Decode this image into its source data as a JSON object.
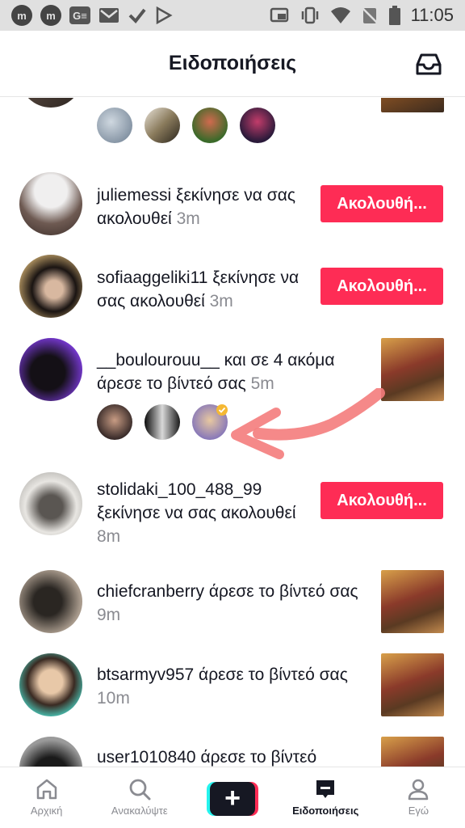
{
  "status_bar": {
    "time": "11:05",
    "left_icons": [
      "m-icon",
      "m-icon",
      "gmail-e-icon",
      "gmail-icon",
      "check-icon",
      "play-store-icon"
    ],
    "right_icons": [
      "cast-icon",
      "vibrate-icon",
      "wifi-icon",
      "no-sim-icon",
      "battery-icon"
    ],
    "m1": "m",
    "m2": "m",
    "ge": "G≡"
  },
  "header": {
    "title": "Ειδοποιήσεις",
    "inbox_icon": "inbox-icon"
  },
  "notifications": [
    {
      "id": "top-partial",
      "mini_avatars": 4
    },
    {
      "id": "juliemessi",
      "user": "juliemessi",
      "text": " ξεκίνησε να σας ακολουθεί ",
      "time": "3m",
      "button": "Ακολουθή..."
    },
    {
      "id": "sofiaaggeliki11",
      "user": "sofiaaggeliki11",
      "text": " ξεκίνησε να σας ακολουθεί ",
      "time": "3m",
      "button": "Ακολουθή..."
    },
    {
      "id": "boulourouu",
      "user": "__boulourouu__",
      "text": " και σε 4 ακόμα άρεσε το βίντεό σας ",
      "time": "5m",
      "mini_avatars": 3
    },
    {
      "id": "stolidaki",
      "user": "stolidaki_100_488_99",
      "text": " ξεκίνησε να σας ακολουθεί ",
      "time": "8m",
      "button": "Ακολουθή..."
    },
    {
      "id": "chiefcranberry",
      "user": "chiefcranberry",
      "text": " άρεσε το βίντεό σας ",
      "time": "9m"
    },
    {
      "id": "btsarmyv957",
      "user": "btsarmyv957",
      "text": " άρεσε το βίντεό σας ",
      "time": "10m"
    },
    {
      "id": "user1010840",
      "user": "user1010840",
      "text": " άρεσε το βίντεό",
      "time": ""
    }
  ],
  "bottom_nav": [
    {
      "label": "Αρχική",
      "icon": "home-icon"
    },
    {
      "label": "Ανακαλύψτε",
      "icon": "search-icon"
    },
    {
      "label": "",
      "icon": "plus-icon"
    },
    {
      "label": "Ειδοποιήσεις",
      "icon": "notifications-icon",
      "active": true
    },
    {
      "label": "Εγώ",
      "icon": "profile-icon"
    }
  ],
  "colors": {
    "accent": "#fe2c55",
    "cyan": "#25f4ee",
    "text": "#161823",
    "muted": "#8a8b91",
    "annotation_arrow": "#f47c7c"
  }
}
